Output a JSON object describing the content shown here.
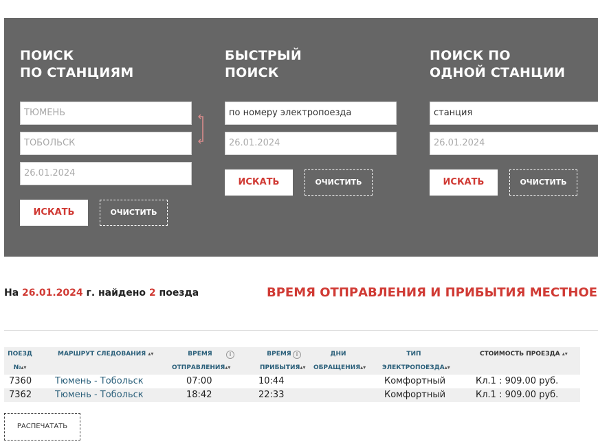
{
  "search_by_stations": {
    "title_line1": "ПОИСК",
    "title_line2": "ПО СТАНЦИЯМ",
    "from_placeholder": "ТЮМЕНЬ",
    "to_placeholder": "ТОБОЛЬСК",
    "date_placeholder": "26.01.2024",
    "search_label": "ИСКАТЬ",
    "clear_label": "ОЧИСТИТЬ"
  },
  "quick_search": {
    "title_line1": "БЫСТРЫЙ",
    "title_line2": "ПОИСК",
    "train_value": "по номеру электропоезда",
    "date_placeholder": "26.01.2024",
    "search_label": "ИСКАТЬ",
    "clear_label": "ОЧИСТИТЬ"
  },
  "single_station": {
    "title_line1": "ПОИСК ПО",
    "title_line2": "ОДНОЙ СТАНЦИИ",
    "station_value": "станция",
    "date_placeholder": "26.01.2024",
    "search_label": "ИСКАТЬ",
    "clear_label": "ОЧИСТИТЬ"
  },
  "summary": {
    "prefix": "На ",
    "date": "26.01.2024",
    "middle": " г. найдено ",
    "count": "2",
    "suffix": " поезда"
  },
  "notice": "ВРЕМЯ ОТПРАВЛЕНИЯ И ПРИБЫТИЯ МЕСТНОЕ",
  "table": {
    "headers": {
      "train_line1": "ПОЕЗД",
      "train_line2": "№",
      "route": "МАРШРУТ СЛЕДОВАНИЯ",
      "dep_line1": "ВРЕМЯ",
      "dep_line2": "ОТПРАВЛЕНИЯ",
      "arr_line1": "ВРЕМЯ",
      "arr_line2": "ПРИБЫТИЯ",
      "days_line1": "ДНИ",
      "days_line2": "ОБРАЩЕНИЯ",
      "type_line1": "ТИП",
      "type_line2": "ЭЛЕКТРОПОЕЗДА",
      "price": "СТОИМОСТЬ ПРОЕЗДА"
    },
    "rows": [
      {
        "train": "7360",
        "route": "Тюмень - Тобольск",
        "departure": "07:00",
        "arrival": "10:44",
        "days": "",
        "type": "Комфортный",
        "price": "Кл.1 : 909.00 руб."
      },
      {
        "train": "7362",
        "route": "Тюмень - Тобольск",
        "departure": "18:42",
        "arrival": "22:33",
        "days": "",
        "type": "Комфортный",
        "price": "Кл.1 : 909.00 руб."
      }
    ]
  },
  "print_label": "РАСПЕЧАТАТЬ",
  "colors": {
    "panel_bg": "#666666",
    "accent_red": "#d03a34",
    "link_blue": "#2a5f7a",
    "swap_icon": "#d98c8c"
  },
  "icons": {
    "swap": "swap-arrows-icon",
    "sort": "sort-arrows-icon",
    "info": "info-circle-icon"
  }
}
